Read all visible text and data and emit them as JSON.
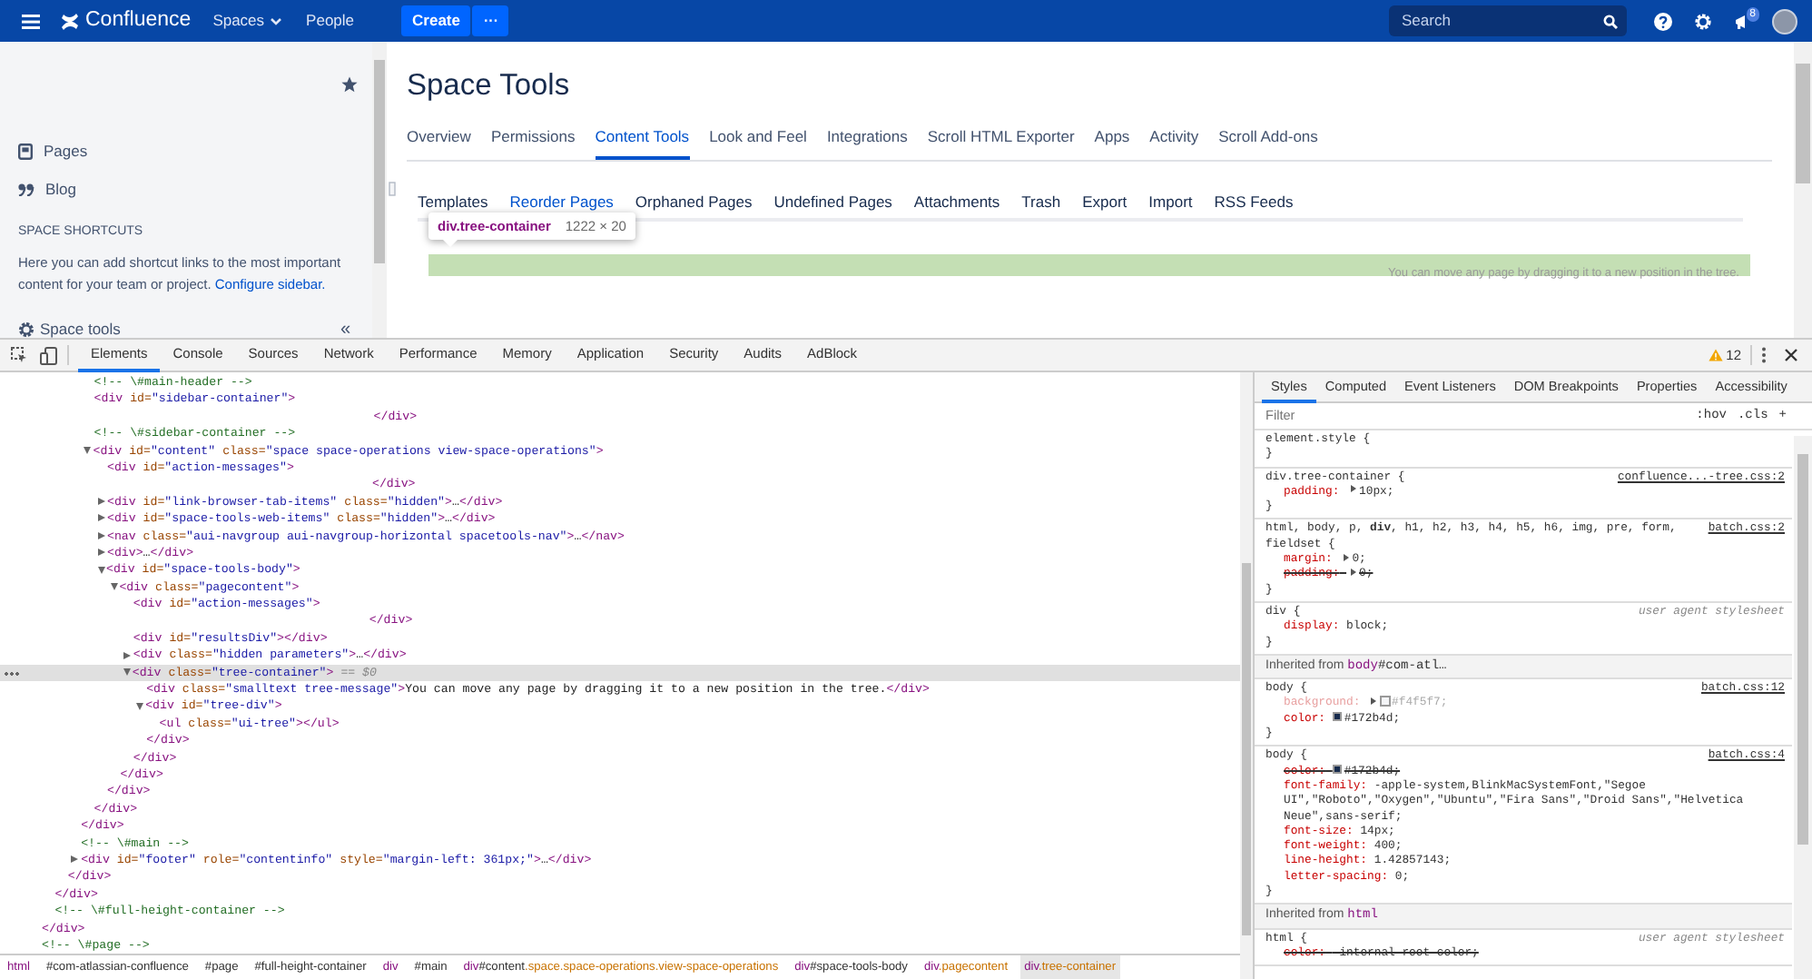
{
  "header": {
    "logo": "Confluence",
    "nav": [
      {
        "label": "Spaces",
        "dropdown": true
      },
      {
        "label": "People",
        "dropdown": false
      }
    ],
    "create": "Create",
    "more": "···",
    "search": {
      "placeholder": "Search"
    },
    "notifications": "8"
  },
  "sidebar": {
    "items": [
      {
        "label": "Pages",
        "kind": "pages"
      },
      {
        "label": "Blog",
        "kind": "blog"
      }
    ],
    "shortcuts_title": "SPACE SHORTCUTS",
    "shortcuts_text": "Here you can add shortcut links to the most important content for your team or project.",
    "shortcuts_link": "Configure sidebar.",
    "space_tools": "Space tools",
    "collapse": "«"
  },
  "content": {
    "title": "Space Tools",
    "tabs": [
      {
        "label": "Overview",
        "selected": false
      },
      {
        "label": "Permissions",
        "selected": false
      },
      {
        "label": "Content Tools",
        "selected": true
      },
      {
        "label": "Look and Feel",
        "selected": false
      },
      {
        "label": "Integrations",
        "selected": false
      },
      {
        "label": "Scroll HTML Exporter",
        "selected": false
      },
      {
        "label": "Apps",
        "selected": false
      },
      {
        "label": "Activity",
        "selected": false
      },
      {
        "label": "Scroll Add-ons",
        "selected": false
      }
    ],
    "subtabs": [
      {
        "label": "Templates",
        "selected": false
      },
      {
        "label": "Reorder Pages",
        "selected": true
      },
      {
        "label": "Orphaned Pages",
        "selected": false
      },
      {
        "label": "Undefined Pages",
        "selected": false
      },
      {
        "label": "Attachments",
        "selected": false
      },
      {
        "label": "Trash",
        "selected": false
      },
      {
        "label": "Export",
        "selected": false
      },
      {
        "label": "Import",
        "selected": false
      },
      {
        "label": "RSS Feeds",
        "selected": false
      }
    ],
    "inspect_tooltip": {
      "selector": "div.tree-container",
      "size": "1222 × 20"
    },
    "tree_message": "You can move any page by dragging it to a new position in the tree."
  },
  "devtools": {
    "tabs": [
      {
        "label": "Elements",
        "selected": true
      },
      {
        "label": "Console",
        "selected": false
      },
      {
        "label": "Sources",
        "selected": false
      },
      {
        "label": "Network",
        "selected": false
      },
      {
        "label": "Performance",
        "selected": false
      },
      {
        "label": "Memory",
        "selected": false
      },
      {
        "label": "Application",
        "selected": false
      },
      {
        "label": "Security",
        "selected": false
      },
      {
        "label": "Audits",
        "selected": false
      },
      {
        "label": "AdBlock",
        "selected": false
      }
    ],
    "warnings": "12",
    "elements": [
      {
        "kind": "end",
        "close": "</div>",
        "selected": false,
        "children": [
          {
            "kind": "end",
            "close": "</div>",
            "selected": false,
            "children": [
              {
                "kind": "end",
                "close": "</div>",
                "selected": false,
                "children": [
                  {
                    "kind": "end",
                    "close": "</div>",
                    "selected": false,
                    "children": [
                      {
                        "kind": "comment",
                        "line": "<!-- \\#main-header -->",
                        "selected": false
                      },
                      {
                        "kind": "spaced",
                        "line": "<div id=\"sidebar-container\">",
                        "close": "</div>",
                        "selected": false
                      },
                      {
                        "kind": "comment",
                        "line": "<!-- \\#sidebar-container -->",
                        "selected": false
                      },
                      {
                        "kind": "element",
                        "line": "<div id=\"content\" class=\"space space-operations view-space-operations\">",
                        "close": "</div>",
                        "expanded": true,
                        "selected": false,
                        "children": [
                          {
                            "kind": "spaced",
                            "line": "<div id=\"action-messages\">",
                            "close": "</div>",
                            "selected": false
                          },
                          {
                            "kind": "element",
                            "line": "<div id=\"link-browser-tab-items\" class=\"hidden\">…</div>",
                            "expanded": false,
                            "selected": false
                          },
                          {
                            "kind": "element",
                            "line": "<div id=\"space-tools-web-items\" class=\"hidden\">…</div>",
                            "expanded": false,
                            "selected": false
                          },
                          {
                            "kind": "element",
                            "line": "<nav class=\"aui-navgroup aui-navgroup-horizontal spacetools-nav\">…</nav>",
                            "expanded": false,
                            "selected": false
                          },
                          {
                            "kind": "element",
                            "line": "<div>…</div>",
                            "expanded": false,
                            "selected": false
                          },
                          {
                            "kind": "element",
                            "line": "<div id=\"space-tools-body\">",
                            "close": "</div>",
                            "expanded": true,
                            "selected": false,
                            "children": [
                              {
                                "kind": "element",
                                "line": "<div class=\"pagecontent\">",
                                "close": "</div>",
                                "expanded": true,
                                "selected": false,
                                "children": [
                                  {
                                    "kind": "spaced",
                                    "line": "<div id=\"action-messages\">",
                                    "close": "</div>",
                                    "selected": false
                                  },
                                  {
                                    "kind": "element",
                                    "line": "<div id=\"resultsDiv\"></div>",
                                    "selected": false
                                  },
                                  {
                                    "kind": "element",
                                    "line": "<div class=\"hidden parameters\">…</div>",
                                    "expanded": false,
                                    "selected": false
                                  },
                                  {
                                    "kind": "element",
                                    "line": "<div class=\"tree-container\">",
                                    "ref": "== $0",
                                    "close": "</div>",
                                    "expanded": true,
                                    "selected": true,
                                    "children": [
                                      {
                                        "kind": "element",
                                        "line": "<div class=\"smalltext tree-message\">You can move any page by dragging it to a new position in the tree.</div>",
                                        "selected": false
                                      },
                                      {
                                        "kind": "element",
                                        "line": "<div id=\"tree-div\">",
                                        "close": "</div>",
                                        "expanded": true,
                                        "selected": false,
                                        "children": [
                                          {
                                            "kind": "element",
                                            "line": "<ul class=\"ui-tree\"></ul>",
                                            "selected": false
                                          }
                                        ]
                                      }
                                    ]
                                  }
                                ]
                              }
                            ]
                          }
                        ]
                      }
                    ]
                  },
                  {
                    "kind": "comment",
                    "line": "<!-- \\#main -->",
                    "selected": false
                  },
                  {
                    "kind": "element",
                    "line": "<div id=\"footer\" role=\"contentinfo\" style=\"margin-left: 361px;\">…</div>",
                    "expanded": false,
                    "selected": false
                  }
                ]
              }
            ]
          },
          {
            "kind": "comment",
            "line": "<!-- \\#full-height-container -->",
            "selected": false
          }
        ]
      },
      {
        "kind": "comment",
        "line": "<!-- \\#page -->",
        "selected": false
      }
    ],
    "breadcrumb": [
      {
        "label": "html",
        "selected": false
      },
      {
        "label": "#com-atlassian-confluence",
        "selected": false
      },
      {
        "label": "#page",
        "selected": false
      },
      {
        "label": "#full-height-container",
        "selected": false
      },
      {
        "label": "div",
        "selected": false
      },
      {
        "label": "#main",
        "selected": false
      },
      {
        "label": "div#content.space.space-operations.view-space-operations",
        "selected": false
      },
      {
        "label": "div#space-tools-body",
        "selected": false
      },
      {
        "label": "div.pagecontent",
        "selected": false
      },
      {
        "label": "div.tree-container",
        "selected": true
      }
    ],
    "styles_tabs": [
      {
        "label": "Styles",
        "selected": true
      },
      {
        "label": "Computed",
        "selected": false
      },
      {
        "label": "Event Listeners",
        "selected": false
      },
      {
        "label": "DOM Breakpoints",
        "selected": false
      },
      {
        "label": "Properties",
        "selected": false
      },
      {
        "label": "Accessibility",
        "selected": false
      }
    ],
    "filter": {
      "placeholder": "Filter"
    },
    "filter_buttons": [
      ":hov",
      ".cls",
      "+"
    ],
    "rules": [
      {
        "kind": "rule",
        "selector": "element.style {",
        "close": "}"
      },
      {
        "kind": "rule",
        "selector": "div.tree-container {",
        "source": "confluence...-tree.css:2",
        "user_agent": false,
        "close": "}",
        "props": [
          {
            "name": "padding:",
            "value": "10px;",
            "expandable": true,
            "struck": false,
            "inactive": false
          }
        ]
      },
      {
        "kind": "rule",
        "selector": "html, body, p, **div**, h1, h2, h3, h4, h5, h6, img, pre, form, fieldset {",
        "source": "batch.css:2",
        "user_agent": false,
        "close": "}",
        "props": [
          {
            "name": "margin:",
            "value": "0;",
            "expandable": true,
            "struck": false,
            "inactive": false
          },
          {
            "name": "padding:",
            "value": "0;",
            "expandable": true,
            "struck": true,
            "inactive": false
          }
        ]
      },
      {
        "kind": "rule",
        "selector": "div {",
        "source": "user agent stylesheet",
        "user_agent": true,
        "close": "}",
        "props": [
          {
            "name": "display:",
            "value": "block;",
            "struck": false,
            "inactive": false
          }
        ]
      },
      {
        "kind": "inherited",
        "label": "Inherited from",
        "target": "body#com-atl…"
      },
      {
        "kind": "rule",
        "selector": "body {",
        "source": "batch.css:12",
        "user_agent": false,
        "close": "}",
        "props": [
          {
            "name": "background:",
            "value": "#f4f5f7;",
            "color": "#f4f5f7",
            "expandable": true,
            "struck": false,
            "inactive": true
          },
          {
            "name": "color:",
            "value": "#172b4d;",
            "color": "#172b4d",
            "struck": false,
            "inactive": false
          }
        ]
      },
      {
        "kind": "rule",
        "selector": "body {",
        "source": "batch.css:4",
        "user_agent": false,
        "close": "}",
        "props": [
          {
            "name": "color:",
            "value": "#172b4d;",
            "color": "#172b4d",
            "struck": true,
            "inactive": false
          },
          {
            "name": "font-family:",
            "value": "-apple-system,BlinkMacSystemFont,\"Segoe UI\",\"Roboto\",\"Oxygen\",\"Ubuntu\",\"Fira Sans\",\"Droid Sans\",\"Helvetica Neue\",sans-serif;",
            "struck": false,
            "inactive": false
          },
          {
            "name": "font-size:",
            "value": "14px;",
            "struck": false,
            "inactive": false
          },
          {
            "name": "font-weight:",
            "value": "400;",
            "struck": false,
            "inactive": false
          },
          {
            "name": "line-height:",
            "value": "1.42857143;",
            "struck": false,
            "inactive": false
          },
          {
            "name": "letter-spacing:",
            "value": "0;",
            "struck": false,
            "inactive": false
          }
        ]
      },
      {
        "kind": "inherited",
        "label": "Inherited from",
        "target": "html"
      },
      {
        "kind": "rule",
        "selector": "html {",
        "source": "user agent stylesheet",
        "user_agent": true,
        "props": [
          {
            "name": "color:",
            "value": "-internal-root-color;",
            "struck": true,
            "inactive": false
          }
        ]
      }
    ]
  }
}
